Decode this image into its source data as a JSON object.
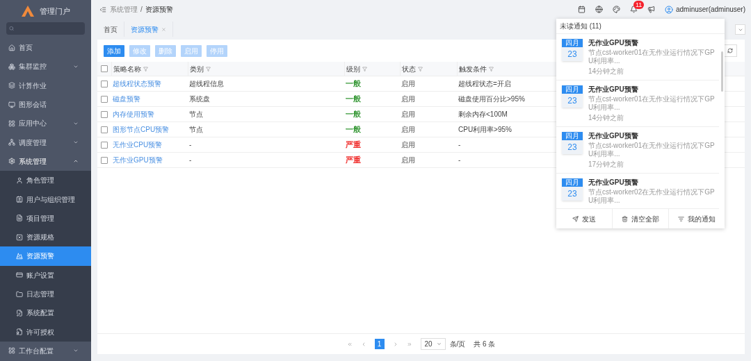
{
  "sidebar": {
    "logo_text": "管理门户",
    "items": [
      {
        "label": "首页"
      },
      {
        "label": "集群监控",
        "expanded": false
      },
      {
        "label": "计算作业"
      },
      {
        "label": "图形会话"
      },
      {
        "label": "应用中心",
        "expanded": false
      },
      {
        "label": "调度管理",
        "expanded": false
      },
      {
        "label": "系统管理",
        "expanded": true,
        "children": [
          {
            "label": "角色管理",
            "selected": false
          },
          {
            "label": "用户与组织管理",
            "selected": false
          },
          {
            "label": "项目管理",
            "selected": false
          },
          {
            "label": "资源规格",
            "selected": false
          },
          {
            "label": "资源预警",
            "selected": true
          },
          {
            "label": "账户设置",
            "selected": false
          },
          {
            "label": "日志管理",
            "selected": false
          },
          {
            "label": "系统配置",
            "selected": false
          },
          {
            "label": "许可授权",
            "selected": false
          }
        ]
      },
      {
        "label": "工作台配置",
        "expanded": false
      }
    ]
  },
  "header": {
    "breadcrumb": [
      {
        "label": "系统管理"
      },
      {
        "label": "资源预警"
      }
    ],
    "breadcrumb_separator": "/",
    "notification_count": "11",
    "user": "adminuser(adminuser)"
  },
  "tabs": [
    {
      "label": "首页",
      "selected": false,
      "closable": false
    },
    {
      "label": "资源预警",
      "selected": true,
      "closable": true
    }
  ],
  "toolbar": [
    {
      "label": "添加",
      "disabled": false
    },
    {
      "label": "修改",
      "disabled": true
    },
    {
      "label": "删除",
      "disabled": true
    },
    {
      "label": "启用",
      "disabled": true
    },
    {
      "label": "停用",
      "disabled": true
    }
  ],
  "table": {
    "all_checked": false,
    "columns": [
      "策略名称",
      "类别",
      "级别",
      "状态",
      "触发条件"
    ],
    "rows": [
      {
        "checked": false,
        "name": "超线程状态预警",
        "type": "超线程信息",
        "level": "一般",
        "color": "#3a9a3a",
        "status": "启用",
        "trigger": "超线程状态=开启"
      },
      {
        "checked": false,
        "name": "磁盘预警",
        "type": "系统盘",
        "level": "一般",
        "color": "#3a9a3a",
        "status": "启用",
        "trigger": "磁盘使用百分比>95%"
      },
      {
        "checked": false,
        "name": "内存使用预警",
        "type": "节点",
        "level": "一般",
        "color": "#3a9a3a",
        "status": "启用",
        "trigger": "剩余内存<100M"
      },
      {
        "checked": false,
        "name": "图形节点CPU预警",
        "type": "节点",
        "level": "一般",
        "color": "#3a9a3a",
        "status": "启用",
        "trigger": "CPU利用率>95%"
      },
      {
        "checked": false,
        "name": "无作业CPU预警",
        "type": "-",
        "level": "严重",
        "color": "#f0302e",
        "status": "启用",
        "trigger": "-"
      },
      {
        "checked": false,
        "name": "无作业GPU预警",
        "type": "-",
        "level": "严重",
        "color": "#f0302e",
        "status": "启用",
        "trigger": "-"
      }
    ]
  },
  "pagination": {
    "pages": [
      {
        "label": "1",
        "selected": true
      }
    ],
    "page_size": "20",
    "page_size_unit": "条/页",
    "total": "共 6 条"
  },
  "notifications": {
    "title": "未读通知 (11)",
    "items": [
      {
        "month": "四月",
        "day": "23",
        "title": "无作业GPU预警",
        "body": "节点cst-worker01在无作业运行情况下GPU利用率...",
        "time": "14分钟之前"
      },
      {
        "month": "四月",
        "day": "23",
        "title": "无作业GPU预警",
        "body": "节点cst-worker01在无作业运行情况下GPU利用率...",
        "time": "14分钟之前"
      },
      {
        "month": "四月",
        "day": "23",
        "title": "无作业GPU预警",
        "body": "节点cst-worker01在无作业运行情况下GPU利用率...",
        "time": "17分钟之前"
      },
      {
        "month": "四月",
        "day": "23",
        "title": "无作业GPU预警",
        "body": "节点cst-worker02在无作业运行情况下GPU利用率..."
      }
    ],
    "actions": [
      {
        "label": "发送"
      },
      {
        "label": "清空全部"
      },
      {
        "label": "我的通知"
      }
    ]
  }
}
